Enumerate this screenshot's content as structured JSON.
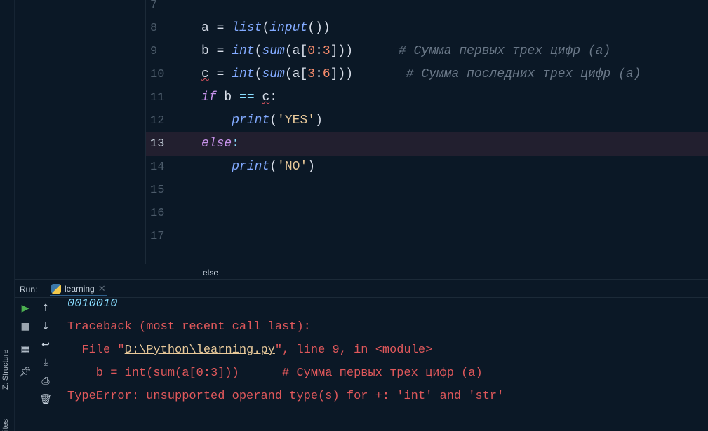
{
  "editor": {
    "line_numbers": [
      "7",
      "8",
      "9",
      "10",
      "11",
      "12",
      "13",
      "14",
      "15",
      "16",
      "17"
    ],
    "current_line": "13",
    "lines": {
      "l8": {
        "var": "a",
        "eq": " = ",
        "f1": "list",
        "p1": "(",
        "f2": "input",
        "p2": "())"
      },
      "l9": {
        "var": "b",
        "eq": " = ",
        "f1": "int",
        "p1": "(",
        "f2": "sum",
        "p2": "(a[",
        "n1": "0",
        ":": ":",
        "n2": "3",
        "p3": "]))",
        "comment": "      # Сумма первых трех цифр (a)"
      },
      "l10": {
        "var": "c",
        "eq": " = ",
        "f1": "int",
        "p1": "(",
        "f2": "sum",
        "p2": "(a[",
        "n1": "3",
        ":": ":",
        "n2": "6",
        "p3": "]))",
        "comment": "       # Сумма последних трех цифр (a)"
      },
      "l11": {
        "kw": "if",
        "mid": " b ",
        "op": "==",
        "sp": " ",
        "var": "c",
        "colon": ":"
      },
      "l12": {
        "indent": "    ",
        "f": "print",
        "p1": "(",
        "s": "'YES'",
        "p2": ")"
      },
      "l13": {
        "kw": "else",
        "colon": ":"
      },
      "l14": {
        "indent": "    ",
        "f": "print",
        "p1": "(",
        "s": "'NO'",
        "p2": ")"
      }
    },
    "breadcrumb": "else"
  },
  "run": {
    "label": "Run:",
    "tab": "learning",
    "console": {
      "input": "0010010",
      "traceback": "Traceback (most recent call last):",
      "file_pre": "  File \"",
      "file_path": "D:\\Python\\learning.py",
      "file_post": "\", line 9, in <module>",
      "code_line": "    b = int(sum(a[0:3]))      # Сумма первых трех цифр (a)",
      "error": "TypeError: unsupported operand type(s) for +: 'int' and 'str'"
    }
  },
  "side": {
    "structure": "Z: Structure",
    "favorites": "ites"
  }
}
